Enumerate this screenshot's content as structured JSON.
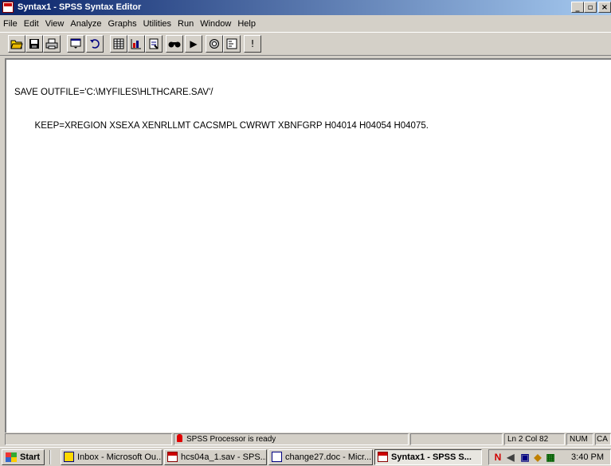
{
  "window": {
    "title": "Syntax1 - SPSS Syntax Editor",
    "min_glyph": "_",
    "max_glyph": "▫",
    "close_glyph": "×"
  },
  "menu": [
    "File",
    "Edit",
    "View",
    "Analyze",
    "Graphs",
    "Utilities",
    "Run",
    "Window",
    "Help"
  ],
  "toolbar": {
    "icons": [
      "open-folder-icon",
      "save-icon",
      "print-icon",
      "dialog-recall-icon",
      "undo-icon",
      "goto-data-icon",
      "goto-chart-icon",
      "variables-icon",
      "find-icon",
      "run-icon",
      "use-sets-icon",
      "syntax-help-icon",
      "designate-window-icon"
    ],
    "run_glyph": "▶",
    "exclaim_glyph": "!"
  },
  "editor": {
    "lines": [
      "SAVE OUTFILE='C:\\MYFILES\\HLTHCARE.SAV'/",
      "        KEEP=XREGION XSEXA XENRLLMT CACSMPL CWRWT XBNFGRP H04014 H04054 H04075."
    ]
  },
  "status": {
    "processor": "SPSS Processor  is ready",
    "position": "Ln 2 Col 82",
    "num": "NUM",
    "caps": "CA"
  },
  "taskbar": {
    "start": "Start",
    "tasks": [
      "Inbox - Microsoft Ou...",
      "hcs04a_1.sav - SPS...",
      "change27.doc - Micr...",
      "Syntax1 - SPSS S..."
    ],
    "clock": "3:40 PM"
  },
  "colors": {
    "titlebar_start": "#0a246a",
    "titlebar_end": "#a6caf0",
    "chrome": "#d4d0c8"
  }
}
